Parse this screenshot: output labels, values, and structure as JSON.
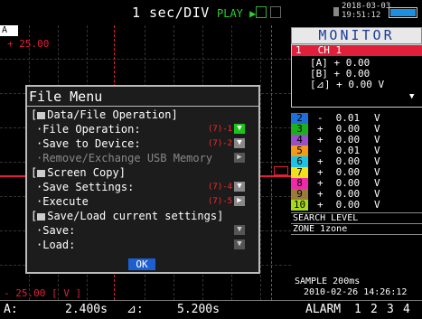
{
  "top": {
    "time_div": "1  sec/DIV",
    "run_state": "PLAY",
    "clock_date": "2018-03-03",
    "clock_time": "19:51:12"
  },
  "plot": {
    "channel_tag": "A",
    "y_max_label": "+ 25.00",
    "y_min_label": "- 25.00 [",
    "y_unit": "V",
    "y_unit_close": "]"
  },
  "monitor": {
    "title": "MONITOR",
    "ch1": {
      "num": "1",
      "name": "CH 1",
      "rows": [
        {
          "label": "[A]",
          "sign": "+",
          "value": "0.00",
          "unit": ""
        },
        {
          "label": "[B]",
          "sign": "+",
          "value": "0.00",
          "unit": ""
        },
        {
          "label": "[⊿]",
          "sign": "+",
          "value": "0.00",
          "unit": "V"
        }
      ]
    },
    "channels": [
      {
        "num": "2",
        "sign": "-",
        "value": "0.01",
        "unit": "V",
        "color": "#1e6fd8"
      },
      {
        "num": "3",
        "sign": "+",
        "value": "0.00",
        "unit": "V",
        "color": "#1bb01b"
      },
      {
        "num": "4",
        "sign": "+",
        "value": "0.00",
        "unit": "V",
        "color": "#9a4fc9"
      },
      {
        "num": "5",
        "sign": "-",
        "value": "0.01",
        "unit": "V",
        "color": "#f29a1a"
      },
      {
        "num": "6",
        "sign": "+",
        "value": "0.00",
        "unit": "V",
        "color": "#1fc2e0"
      },
      {
        "num": "7",
        "sign": "+",
        "value": "0.00",
        "unit": "V",
        "color": "#f2e01a"
      },
      {
        "num": "8",
        "sign": "+",
        "value": "0.00",
        "unit": "V",
        "color": "#ee2aa8"
      },
      {
        "num": "9",
        "sign": "+",
        "value": "0.00",
        "unit": "V",
        "color": "#9a7a3a"
      },
      {
        "num": "10",
        "sign": "+",
        "value": "0.00",
        "unit": "V",
        "color": "#a8d81a"
      }
    ],
    "search_level": "SEARCH LEVEL",
    "zone_label": "ZONE",
    "zone_value": "1zone",
    "sample_label": "SAMPLE",
    "sample_value": "200ms",
    "sample_datetime": "2010-02-26 14:26:12"
  },
  "bottom": {
    "a_label": "A:",
    "a_value": "2.400s",
    "delta_label": "⊿:",
    "delta_value": "5.200s",
    "alarm_label": "ALARM",
    "alarm_nums": [
      "1",
      "2",
      "3",
      "4"
    ]
  },
  "dialog": {
    "title": "File Menu",
    "sec1": "Data/File Operation]",
    "file_operation": "·File Operation:",
    "file_operation_ref": "(7)-1",
    "save_to_device": "·Save to Device:",
    "save_to_device_ref": "(7)-2",
    "remove_usb": "·Remove/Exchange USB Memory",
    "sec2": "Screen Copy]",
    "save_settings": "·Save Settings:",
    "save_settings_ref": "(7)-4",
    "execute": "·Execute",
    "execute_ref": "(7)-5",
    "sec3": "Save/Load current settings]",
    "save": "·Save:",
    "load": "·Load:",
    "ok": "OK"
  }
}
